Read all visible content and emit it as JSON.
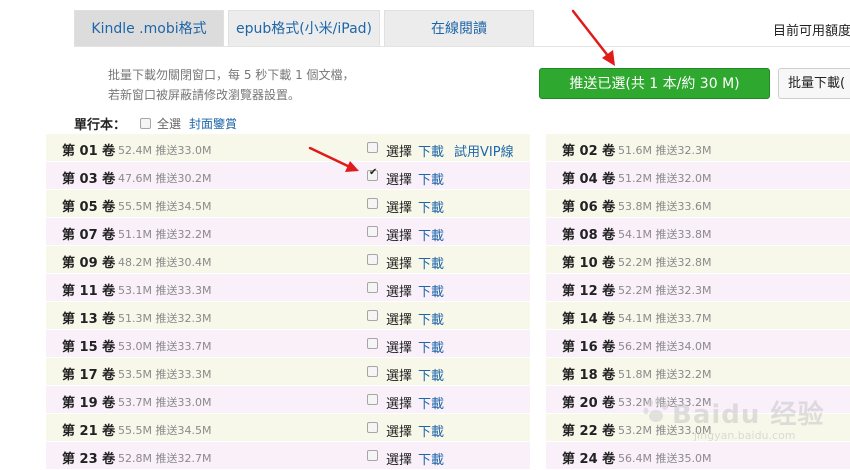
{
  "tabs": [
    {
      "label": "Kindle .mobi格式",
      "active": true
    },
    {
      "label": "epub格式(小米/iPad)",
      "active": false
    },
    {
      "label": "在線閱讀",
      "active": false
    }
  ],
  "quota_label": "目前可用額度",
  "notes": [
    "批量下載勿關閉窗口，每 5 秒下載 1 個文檔，",
    "若新窗口被屏蔽請修改瀏覽器設置。"
  ],
  "send_button": "推送已選(共 1 本/約 30 M)",
  "batch_button": "批量下載(",
  "volume_header": {
    "label": "單行本：",
    "select_all": "全選",
    "cover_link": "封面鑒賞"
  },
  "row_labels": {
    "select": "選擇",
    "download": "下載",
    "vip": "試用VIP線"
  },
  "rows_left": [
    {
      "name": "第 01 卷",
      "size": "52.4M 推送33.0M",
      "checked": false,
      "vip": true
    },
    {
      "name": "第 03 卷",
      "size": "47.6M 推送30.2M",
      "checked": true,
      "vip": false
    },
    {
      "name": "第 05 卷",
      "size": "55.5M 推送34.5M",
      "checked": false,
      "vip": false
    },
    {
      "name": "第 07 卷",
      "size": "51.1M 推送32.2M",
      "checked": false,
      "vip": false
    },
    {
      "name": "第 09 卷",
      "size": "48.2M 推送30.4M",
      "checked": false,
      "vip": false
    },
    {
      "name": "第 11 卷",
      "size": "53.1M 推送33.3M",
      "checked": false,
      "vip": false
    },
    {
      "name": "第 13 卷",
      "size": "51.3M 推送32.3M",
      "checked": false,
      "vip": false
    },
    {
      "name": "第 15 卷",
      "size": "53.0M 推送33.7M",
      "checked": false,
      "vip": false
    },
    {
      "name": "第 17 卷",
      "size": "53.5M 推送33.3M",
      "checked": false,
      "vip": false
    },
    {
      "name": "第 19 卷",
      "size": "53.7M 推送33.0M",
      "checked": false,
      "vip": false
    },
    {
      "name": "第 21 卷",
      "size": "55.5M 推送34.5M",
      "checked": false,
      "vip": false
    },
    {
      "name": "第 23 卷",
      "size": "52.8M 推送32.7M",
      "checked": false,
      "vip": false
    }
  ],
  "rows_right": [
    {
      "name": "第 02 卷",
      "size": "51.6M 推送32.3M"
    },
    {
      "name": "第 04 卷",
      "size": "51.2M 推送32.0M"
    },
    {
      "name": "第 06 卷",
      "size": "53.8M 推送33.6M"
    },
    {
      "name": "第 08 卷",
      "size": "54.1M 推送33.8M"
    },
    {
      "name": "第 10 卷",
      "size": "52.2M 推送32.8M"
    },
    {
      "name": "第 12 卷",
      "size": "52.2M 推送32.3M"
    },
    {
      "name": "第 14 卷",
      "size": "54.1M 推送33.7M"
    },
    {
      "name": "第 16 卷",
      "size": "56.2M 推送34.0M"
    },
    {
      "name": "第 18 卷",
      "size": "51.8M 推送32.2M"
    },
    {
      "name": "第 20 卷",
      "size": "53.2M 推送33.2M"
    },
    {
      "name": "第 22 卷",
      "size": "53.2M 推送33.0M"
    },
    {
      "name": "第 24 卷",
      "size": "56.4M 推送35.0M"
    }
  ],
  "watermark": {
    "text": "Baidu 经验",
    "url": "jingyan.baidu.com"
  },
  "colors": {
    "send_button": "#2ea82e",
    "link": "#1f66a8",
    "arrow": "#e01b1b",
    "row_odd": "#f8f8ea",
    "row_even": "#faf0fa"
  },
  "icons": [
    "checkbox-icon",
    "red-arrow-icon",
    "paw-icon"
  ]
}
